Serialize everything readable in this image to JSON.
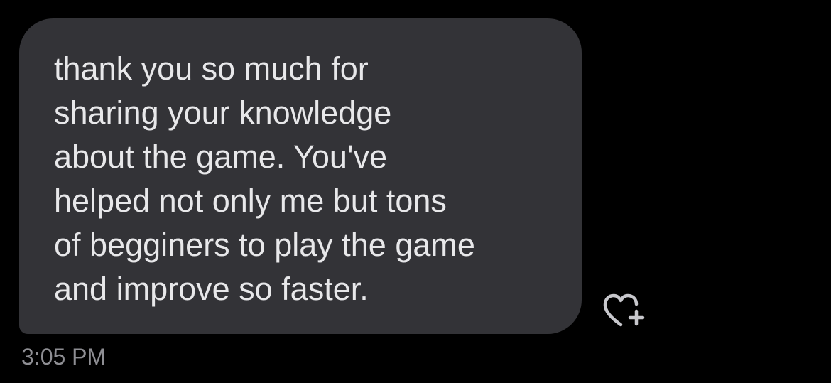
{
  "message": {
    "lines": [
      "thank you so much for",
      "sharing your knowledge",
      "about the game. You've",
      "helped not only me but tons",
      "of begginers to play the game",
      "and improve so faster."
    ],
    "timestamp": "3:05 PM"
  },
  "reaction_button": {
    "icon": "heart-plus-icon"
  },
  "colors": {
    "background": "#000000",
    "bubble": "#333337",
    "message_text": "#e8e8ea",
    "timestamp_text": "#8e8e93",
    "icon_stroke": "#c7c7cc"
  }
}
